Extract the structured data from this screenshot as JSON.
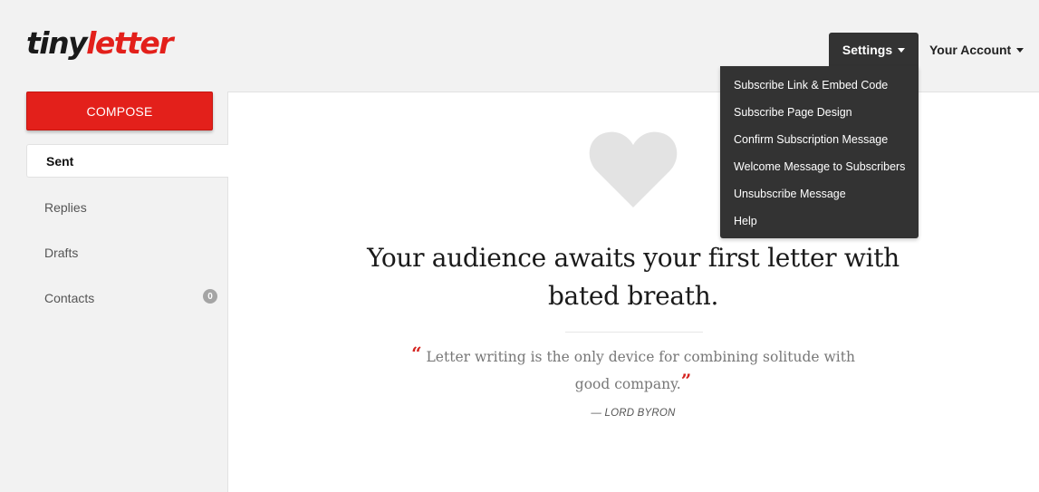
{
  "brand": {
    "logo_tiny": "tiny",
    "logo_letter": "letter",
    "accent": "#e3201b"
  },
  "topnav": {
    "settings_label": "Settings",
    "account_label": "Your Account"
  },
  "settings_menu": {
    "items": [
      "Subscribe Link & Embed Code",
      "Subscribe Page Design",
      "Confirm Subscription Message",
      "Welcome Message to Subscribers",
      "Unsubscribe Message",
      "Help"
    ]
  },
  "sidebar": {
    "compose_label": "COMPOSE",
    "items": [
      {
        "label": "Sent"
      },
      {
        "label": "Replies"
      },
      {
        "label": "Drafts"
      },
      {
        "label": "Contacts",
        "badge": "0"
      }
    ]
  },
  "main": {
    "icon": "heart-icon",
    "headline": "Your audience awaits your first letter with bated breath.",
    "open_quote": "“",
    "quote": "Letter writing is the only device for combining solitude with good company.",
    "close_quote": "”",
    "author": "— LORD BYRON"
  }
}
